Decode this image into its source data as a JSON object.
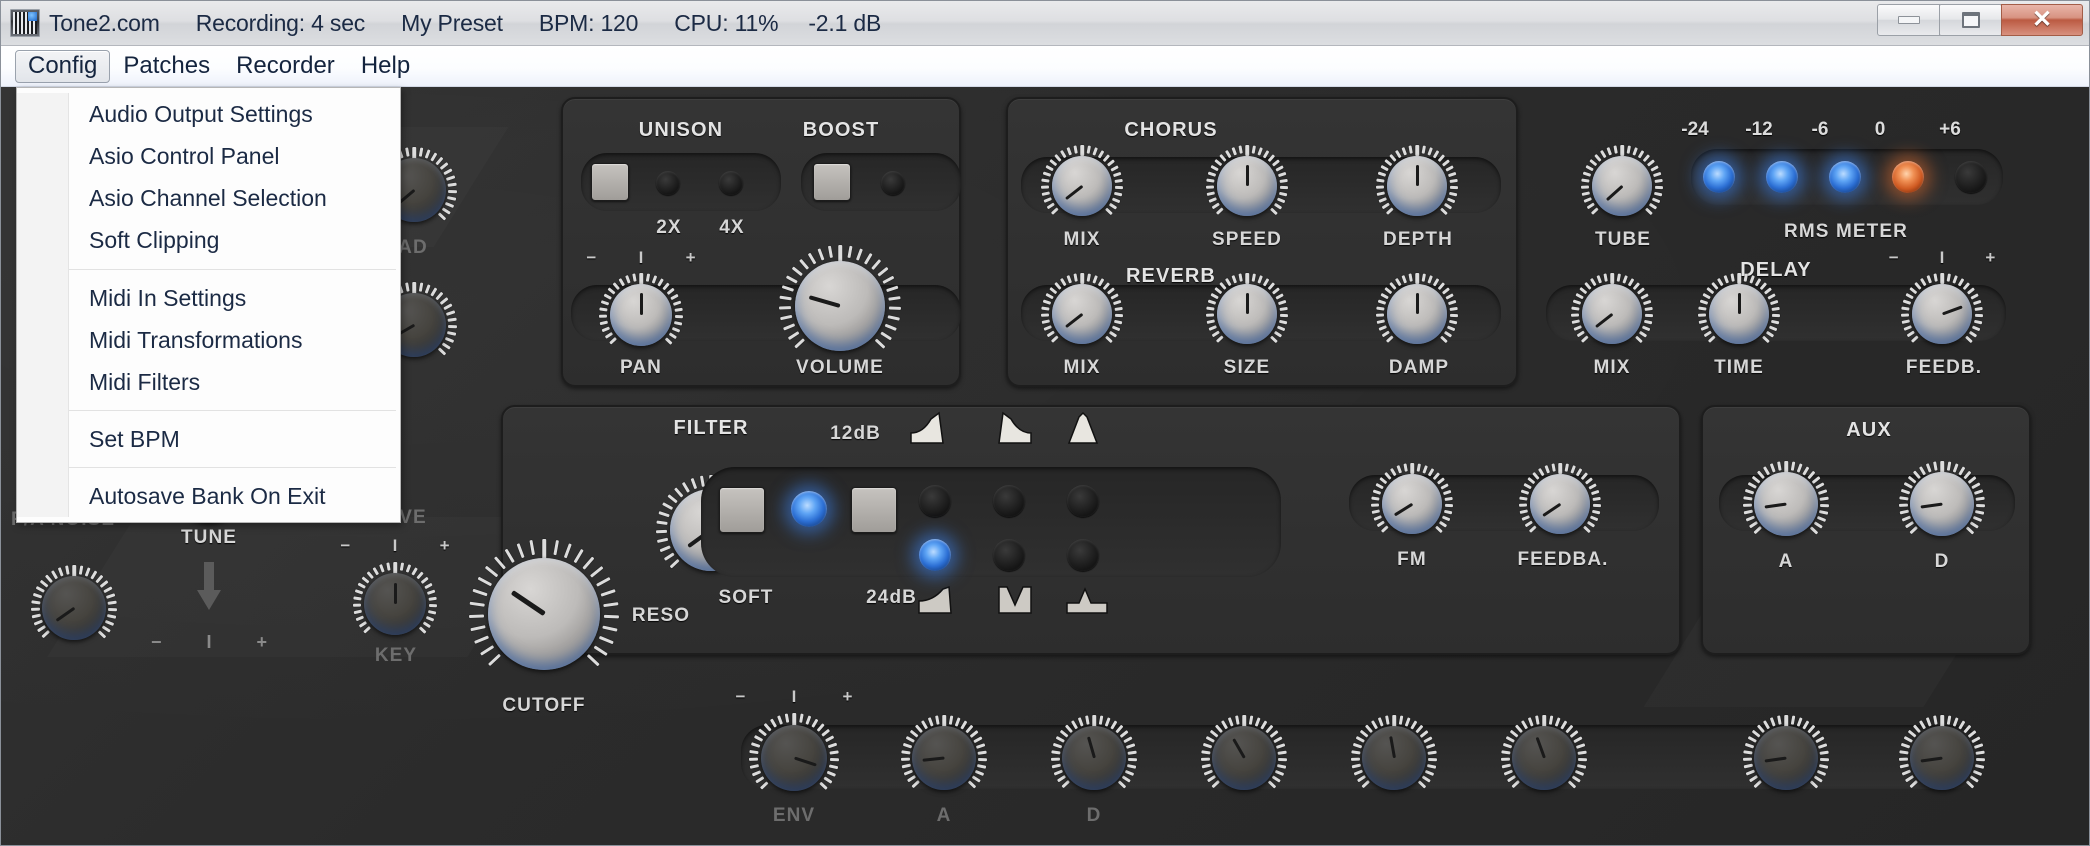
{
  "window": {
    "app_icon": "piano-keyboard-icon",
    "title_items": [
      {
        "name": "brand",
        "text": "Tone2.com"
      },
      {
        "name": "recording",
        "text": "Recording: 4 sec"
      },
      {
        "name": "preset",
        "text": "My Preset"
      },
      {
        "name": "bpm",
        "text": "BPM: 120"
      },
      {
        "name": "cpu",
        "text": "CPU: 11%"
      },
      {
        "name": "level",
        "text": "-2.1 dB"
      }
    ],
    "controls": {
      "minimize": "minimize-button",
      "maximize": "maximize-button",
      "close": "close-button",
      "close_glyph": "✕"
    }
  },
  "menubar": {
    "items": [
      {
        "label": "Config",
        "active": true
      },
      {
        "label": "Patches",
        "active": false
      },
      {
        "label": "Recorder",
        "active": false
      },
      {
        "label": "Help",
        "active": false
      }
    ]
  },
  "dropdown": {
    "open_menu": "Config",
    "groups": [
      [
        "Audio Output Settings",
        "Asio Control Panel",
        "Asio Channel Selection",
        "Soft Clipping"
      ],
      [
        "Midi In Settings",
        "Midi Transformations",
        "Midi Filters"
      ],
      [
        "Set BPM"
      ],
      [
        "Autosave Bank On Exit"
      ]
    ]
  },
  "synth": {
    "colors": {
      "panel_bg": "#2d2d2d",
      "panel_border": "#1d1d1d",
      "led_blue": "#3c82eb",
      "led_orange": "#e66e2d",
      "label_text": "#d7d7d7"
    },
    "sections": {
      "unison": {
        "title": "UNISON",
        "mult_labels": [
          "2X",
          "4X"
        ]
      },
      "boost": {
        "title": "BOOST"
      },
      "output": {
        "pan_label": "PAN",
        "volume_label": "VOLUME",
        "pm_minus": "−",
        "pm_mid": "I",
        "pm_plus": "+"
      },
      "hidden_left": {
        "spread_partial": "AD",
        "fa_noise": "F/A NOISE",
        "tune": "TUNE",
        "drive": "DRIVE",
        "key": "KEY"
      },
      "chorus": {
        "title": "CHORUS",
        "knobs": [
          "MIX",
          "SPEED",
          "DEPTH"
        ]
      },
      "reverb": {
        "title": "REVERB",
        "knobs": [
          "MIX",
          "SIZE",
          "DAMP"
        ]
      },
      "tube": {
        "label": "TUBE"
      },
      "rms_meter": {
        "label": "RMS METER",
        "scale": [
          "-24",
          "-12",
          "-6",
          "0",
          "+6"
        ],
        "led_states": [
          "blue",
          "blue",
          "blue",
          "orange",
          "off"
        ]
      },
      "delay": {
        "title": "DELAY",
        "knobs": [
          "MIX",
          "TIME",
          "FEEDB."
        ]
      },
      "filter": {
        "title": "FILTER",
        "cutoff_label": "CUTOFF",
        "reso_label": "RESO",
        "soft_label": "SOFT",
        "slope_12": "12dB",
        "slope_24": "24dB",
        "shapes_top": [
          "lowpass-12-icon",
          "highpass-12-icon",
          "bandpass-12-icon"
        ],
        "shapes_bottom": [
          "lowpass-24-icon",
          "notch-24-icon",
          "bandreject-24-icon"
        ],
        "led_grid": [
          [
            "off",
            "off",
            "off"
          ],
          [
            "blue",
            "off",
            "off"
          ]
        ],
        "soft_led": "blue"
      },
      "fm": {
        "knobs": [
          "FM",
          "FEEDBA."
        ]
      },
      "aux": {
        "title": "AUX",
        "knobs": [
          "A",
          "D"
        ]
      },
      "bottom_partial": {
        "env_label": "ENV",
        "a_label": "A",
        "d_label": "D"
      }
    }
  }
}
